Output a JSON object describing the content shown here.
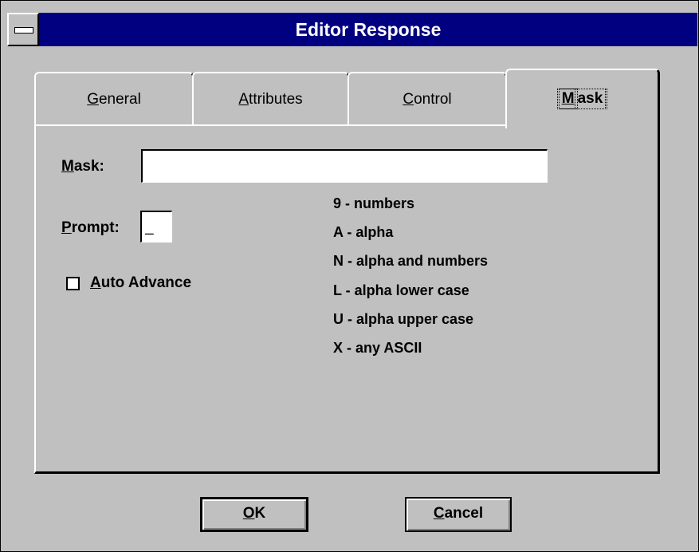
{
  "window": {
    "title": "Editor Response"
  },
  "tabs": [
    {
      "mnemonic": "G",
      "rest": "eneral",
      "active": false
    },
    {
      "mnemonic": "A",
      "rest": "ttributes",
      "active": false
    },
    {
      "mnemonic": "C",
      "rest": "ontrol",
      "active": false
    },
    {
      "mnemonic": "M",
      "rest": "ask",
      "active": true
    }
  ],
  "mask": {
    "label_mnemonic": "M",
    "label_rest": "ask:",
    "value": ""
  },
  "prompt": {
    "label_mnemonic": "P",
    "label_rest": "rompt:",
    "value": "_"
  },
  "auto_advance": {
    "label_mnemonic": "A",
    "label_rest": "uto Advance",
    "checked": false
  },
  "legend": [
    "9 - numbers",
    "A - alpha",
    "N - alpha and numbers",
    "L - alpha lower case",
    "U - alpha upper case",
    "X - any ASCII"
  ],
  "buttons": {
    "ok": {
      "mnemonic": "O",
      "rest": "K"
    },
    "cancel": {
      "mnemonic": "C",
      "rest": "ancel"
    }
  },
  "colors": {
    "titlebar": "#000080",
    "face": "#c0c0c0",
    "field": "#ffffff"
  }
}
